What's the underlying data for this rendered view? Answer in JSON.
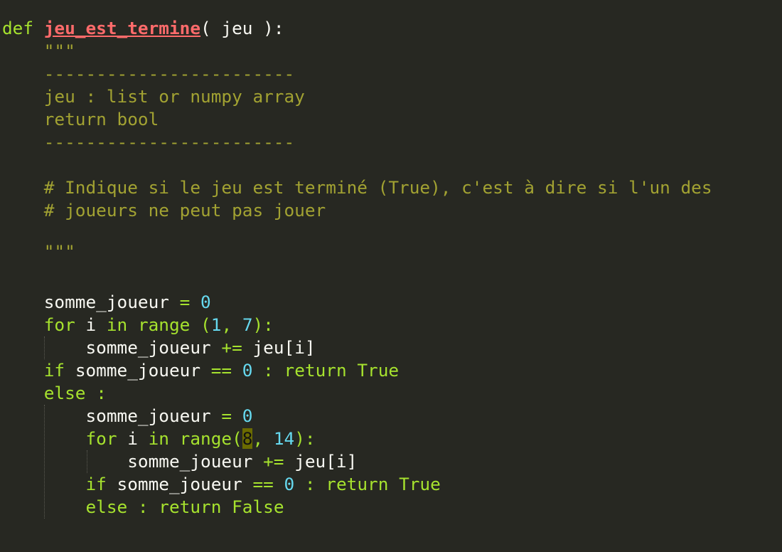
{
  "code": {
    "l1": {
      "kw": "def",
      "name": "jeu_est_termine",
      "args": "( jeu ):"
    },
    "l2": "\"\"\"",
    "l3": "------------------------",
    "l4": "jeu : list or numpy array",
    "l5": "return bool",
    "l6": "------------------------",
    "l8": "# Indique si le jeu est terminé (True), c'est à dire si l'un des",
    "l9": "# joueurs ne peut pas jouer",
    "l11": "\"\"\"",
    "l13": {
      "var": "somme_joueur",
      "op": "=",
      "num": "0"
    },
    "l14": {
      "kw": "for",
      "var": "i",
      "kw2": "in",
      "fn": "range",
      "open": " (",
      "n1": "1",
      "comma": ", ",
      "n2": "7",
      "close": "):"
    },
    "l15": {
      "var": "somme_joueur",
      "op": "+=",
      "rest": "jeu[i]"
    },
    "l16": {
      "kw": "if",
      "var": "somme_joueur",
      "op": "==",
      "num": "0",
      "colon": ":",
      "ret": "return",
      "val": "True"
    },
    "l17": {
      "kw": "else",
      "colon": ":"
    },
    "l18": {
      "var": "somme_joueur",
      "op": "=",
      "num": "0"
    },
    "l19": {
      "kw": "for",
      "var": "i",
      "kw2": "in",
      "fn": "range",
      "open": "(",
      "n1": "8",
      "comma": ", ",
      "n2": "14",
      "close": "):"
    },
    "l20": {
      "var": "somme_joueur",
      "op": "+=",
      "rest": "jeu[i]"
    },
    "l21": {
      "kw": "if",
      "var": "somme_joueur",
      "op": "==",
      "num": "0",
      "colon": ":",
      "ret": "return",
      "val": "True"
    },
    "l22": {
      "kw": "else",
      "colon": ":",
      "ret": "return",
      "val": "False"
    }
  },
  "colors": {
    "background": "#272822",
    "keyword": "#a6e22e",
    "function_name": "#ff6b6b",
    "docstring": "#a2a232",
    "number": "#66d9ef",
    "text": "#f8f8f2",
    "bracket_highlight": "#6b6b00"
  }
}
